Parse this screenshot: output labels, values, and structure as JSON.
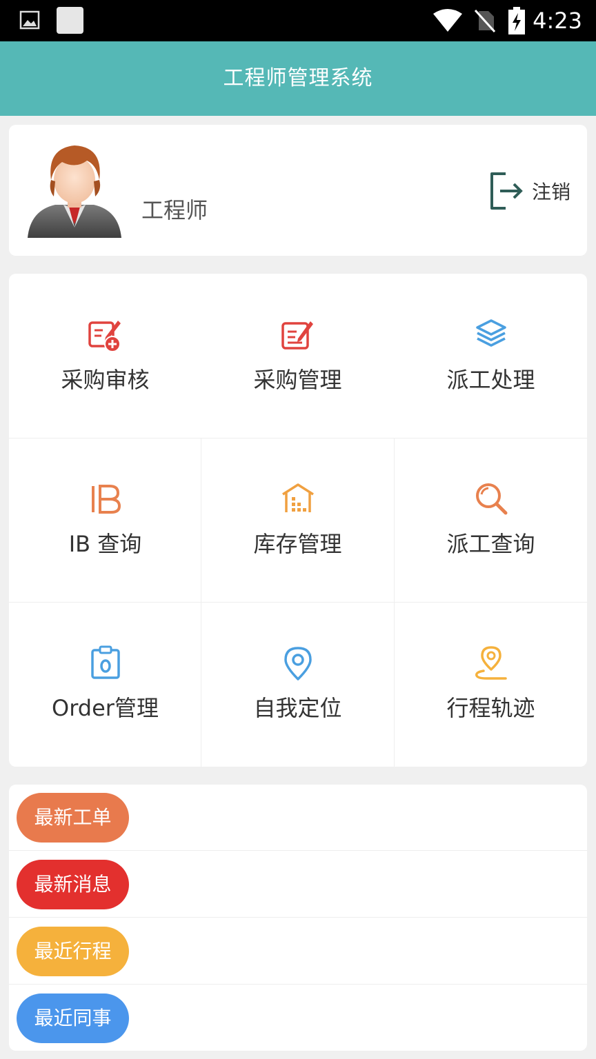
{
  "status_bar": {
    "time": "4:23",
    "icons": [
      "gallery-icon",
      "notification-square-icon",
      "wifi-icon",
      "no-sim-icon",
      "battery-charging-icon"
    ]
  },
  "app_bar": {
    "title": "工程师管理系统",
    "color": "#55b8b6"
  },
  "profile": {
    "avatar_icon": "user-avatar-female",
    "role": "工程师",
    "logout_label": "注销",
    "logout_icon": "logout-icon"
  },
  "menu": {
    "items": [
      {
        "label": "采购审核",
        "icon": "edit-add-icon",
        "color": "#e0433e"
      },
      {
        "label": "采购管理",
        "icon": "edit-icon",
        "color": "#e0433e"
      },
      {
        "label": "派工处理",
        "icon": "layers-icon",
        "color": "#4a9fe0"
      },
      {
        "label": "IB 查询",
        "icon": "ib-icon",
        "color": "#e8814e"
      },
      {
        "label": "库存管理",
        "icon": "warehouse-icon",
        "color": "#f0a040"
      },
      {
        "label": "派工查询",
        "icon": "search-icon",
        "color": "#e8814e"
      },
      {
        "label": "Order管理",
        "icon": "clipboard-icon",
        "color": "#4a9fe0"
      },
      {
        "label": "自我定位",
        "icon": "location-pin-icon",
        "color": "#4a9fe0"
      },
      {
        "label": "行程轨迹",
        "icon": "route-pin-icon",
        "color": "#f5b13c"
      }
    ]
  },
  "quick_list": [
    {
      "label": "最新工单",
      "color": "#e87a4d"
    },
    {
      "label": "最新消息",
      "color": "#e3302e"
    },
    {
      "label": "最近行程",
      "color": "#f5b13c"
    },
    {
      "label": "最近同事",
      "color": "#4b96ec"
    }
  ]
}
